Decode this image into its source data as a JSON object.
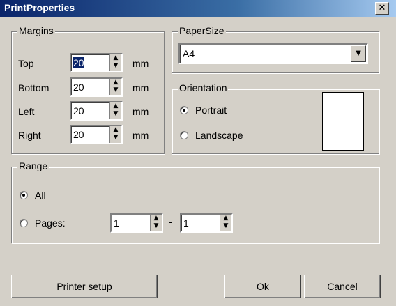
{
  "window": {
    "title": "PrintProperties",
    "close_glyph": "✕"
  },
  "margins": {
    "legend": "Margins",
    "unit": "mm",
    "rows": [
      {
        "label": "Top",
        "value": "20"
      },
      {
        "label": "Bottom",
        "value": "20"
      },
      {
        "label": "Left",
        "value": "20"
      },
      {
        "label": "Right",
        "value": "20"
      }
    ]
  },
  "papersize": {
    "legend": "PaperSize",
    "selected": "A4"
  },
  "orientation": {
    "legend": "Orientation",
    "portrait": "Portrait",
    "landscape": "Landscape",
    "selected": "Portrait"
  },
  "range": {
    "legend": "Range",
    "all": "All",
    "pages": "Pages:",
    "from": "1",
    "dash": "-",
    "to": "1",
    "selected": "All"
  },
  "buttons": {
    "printer_setup": "Printer setup",
    "ok": "Ok",
    "cancel": "Cancel"
  },
  "icons": {
    "spin_up": "▲",
    "spin_down": "▼",
    "dropdown": "▼"
  }
}
